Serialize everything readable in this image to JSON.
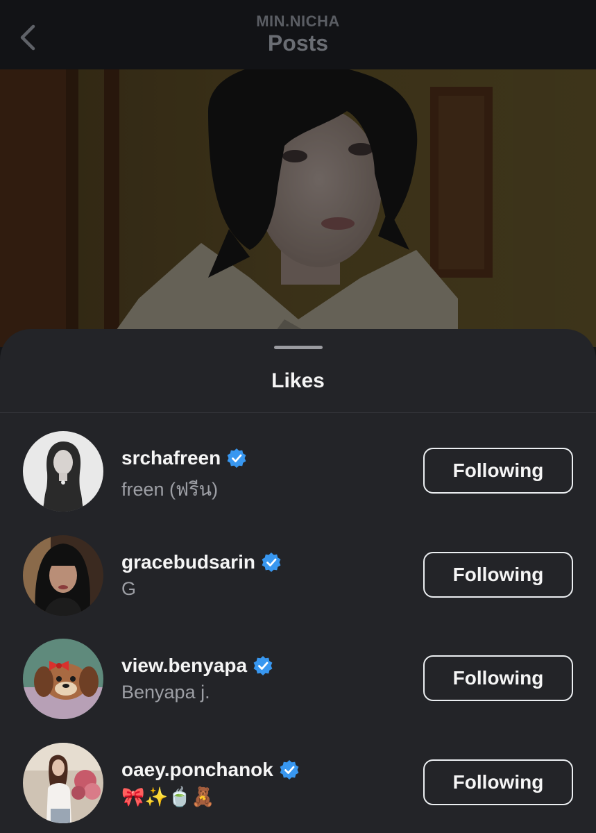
{
  "header": {
    "username": "MIN.NICHA",
    "title": "Posts"
  },
  "likes_sheet": {
    "title": "Likes",
    "users": [
      {
        "username": "srchafreen",
        "full_name": "freen (ฟรีน)",
        "verified": true,
        "button_label": "Following"
      },
      {
        "username": "gracebudsarin",
        "full_name": "G",
        "verified": true,
        "button_label": "Following"
      },
      {
        "username": "view.benyapa",
        "full_name": "Benyapa j.",
        "verified": true,
        "button_label": "Following"
      },
      {
        "username": "oaey.ponchanok",
        "full_name": "🎀✨🍵🧸",
        "verified": true,
        "button_label": "Following"
      }
    ]
  },
  "colors": {
    "verified_badge": "#3897f0",
    "sheet_background": "#232428",
    "text_primary": "#f5f5f5",
    "text_secondary": "#9d9fa5"
  }
}
